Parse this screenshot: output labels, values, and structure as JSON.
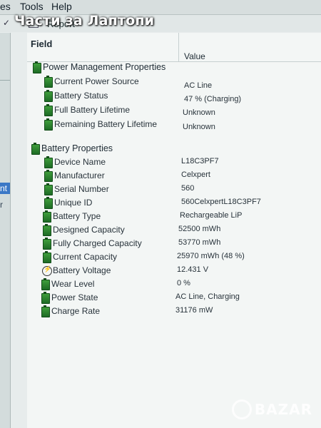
{
  "menubar": {
    "items": [
      "es",
      "Tools",
      "Help"
    ]
  },
  "overlay_title": "Части за Лаптопи",
  "toolbar": {
    "report_label": "Report"
  },
  "leftpane": {
    "selected_text": "nt",
    "sub_text": "r"
  },
  "columns": {
    "field": "Field",
    "value": "Value"
  },
  "power_management": {
    "title": "Power Management Properties",
    "rows": [
      {
        "label": "Current Power Source",
        "value": "AC Line"
      },
      {
        "label": "Battery Status",
        "value": "47 % (Charging)"
      },
      {
        "label": "Full Battery Lifetime",
        "value": "Unknown"
      },
      {
        "label": "Remaining Battery Lifetime",
        "value": "Unknown"
      }
    ]
  },
  "battery": {
    "title": "Battery Properties",
    "rows": [
      {
        "label": "Device Name",
        "value": "L18C3PF7"
      },
      {
        "label": "Manufacturer",
        "value": "Celxpert"
      },
      {
        "label": "Serial Number",
        "value": "560"
      },
      {
        "label": "Unique ID",
        "value": "560CelxpertL18C3PF7"
      },
      {
        "label": "Battery Type",
        "value": "Rechargeable LiP"
      },
      {
        "label": "Designed Capacity",
        "value": "52500 mWh"
      },
      {
        "label": "Fully Charged Capacity",
        "value": "53770 mWh"
      },
      {
        "label": "Current Capacity",
        "value": "25970 mWh  (48 %)"
      },
      {
        "label": "Battery Voltage",
        "value": "12.431 V"
      },
      {
        "label": "Wear Level",
        "value": "0 %"
      },
      {
        "label": "Power State",
        "value": "AC Line, Charging"
      },
      {
        "label": "Charge Rate",
        "value": "31176 mW"
      }
    ]
  },
  "watermark": "BAZAR"
}
